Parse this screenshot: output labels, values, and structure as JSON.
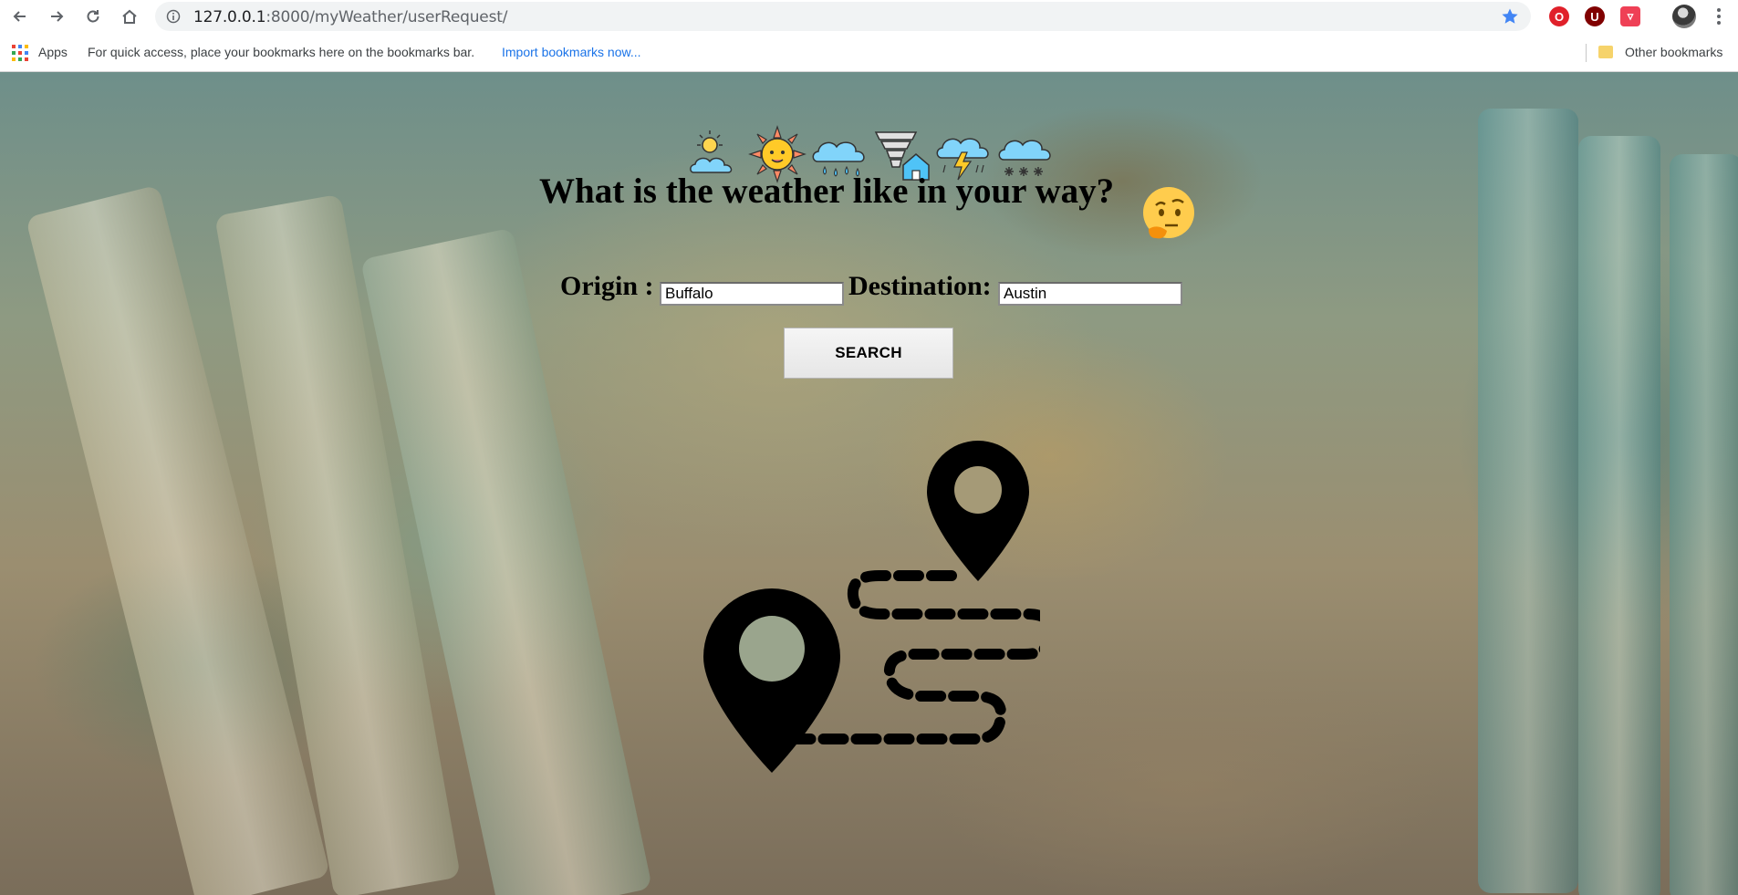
{
  "browser": {
    "url_host": "127.0.0.1",
    "url_path": ":8000/myWeather/userRequest/",
    "extensions": [
      {
        "name": "opera-icon",
        "color": "#e0202a",
        "glyph": "O"
      },
      {
        "name": "ublock-icon",
        "color": "#800000",
        "glyph": "U"
      },
      {
        "name": "pocket-icon",
        "color": "#ef4056",
        "glyph": "▿"
      }
    ]
  },
  "bookmarks_bar": {
    "apps_label": "Apps",
    "hint": "For quick access, place your bookmarks here on the bookmarks bar.",
    "import_link": "Import bookmarks now...",
    "other_bookmarks": "Other bookmarks"
  },
  "page": {
    "weather_icons": [
      "sun-cloud-icon",
      "sun-icon",
      "rain-cloud-icon",
      "tornado-house-icon",
      "thunderstorm-icon",
      "snow-cloud-icon"
    ],
    "headline": "What is the weather like in your way?",
    "thinking_emoji": "thinking-face-icon",
    "origin_label": "Origin :",
    "origin_value": "Buffalo",
    "destination_label": "Destination:",
    "destination_value": "Austin",
    "search_button": "SEARCH",
    "route_graphic": "route-map-pins-icon"
  }
}
